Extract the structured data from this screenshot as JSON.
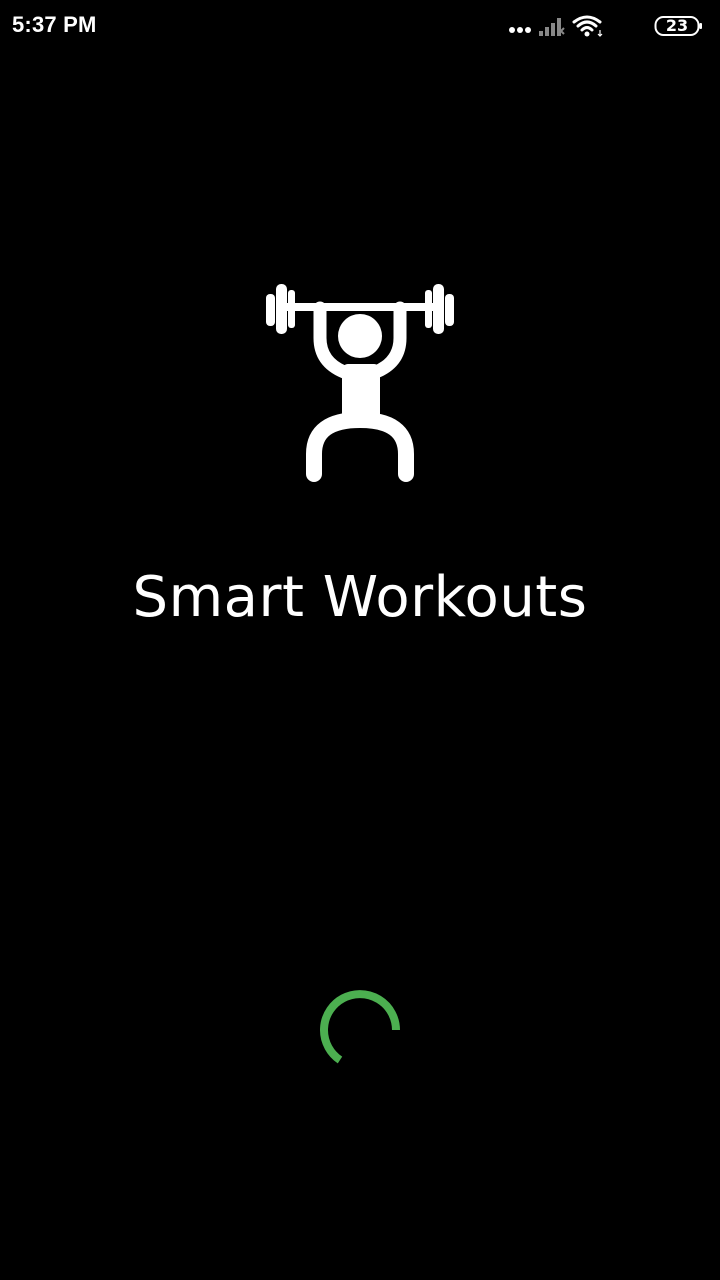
{
  "status_bar": {
    "time": "5:37 PM",
    "battery_level": "23",
    "icons": [
      "dots-icon",
      "signal-icon",
      "wifi-icon",
      "battery-icon"
    ]
  },
  "splash": {
    "logo_icon": "weightlifter-icon",
    "title": "Smart Workouts"
  },
  "loading": {
    "indicator": "loading-spinner-icon",
    "color": "#4caf50"
  },
  "colors": {
    "background": "#000000",
    "foreground": "#ffffff",
    "accent": "#4caf50"
  }
}
